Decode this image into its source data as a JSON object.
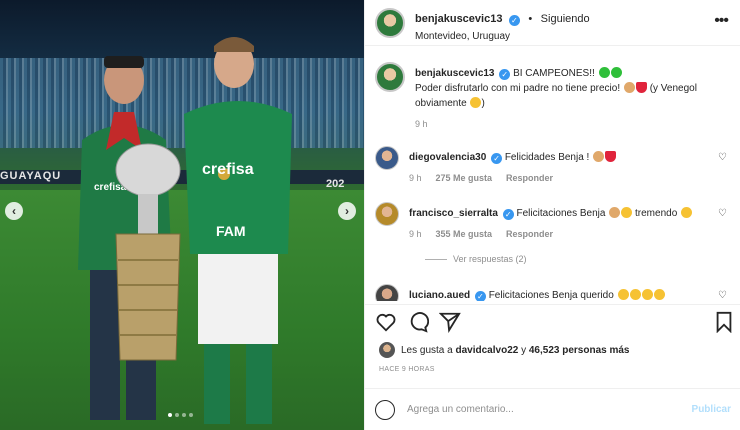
{
  "header": {
    "username": "benjakuscevic13",
    "follow_status": "Siguiendo",
    "location": "Montevideo, Uruguay"
  },
  "media": {
    "board_text_left": "GUAYAQU",
    "board_text_right": "202",
    "shirt_text": "crefisa",
    "sponsor_text": "FAM"
  },
  "caption": {
    "username": "benjakuscevic13",
    "text_1": "BI CAMPEONES!!",
    "text_2": "Poder disfrutarlo con mi padre no tiene precio!",
    "text_3": "(y Venegol obviamente",
    "text_4": ")",
    "time": "9 h"
  },
  "comments": [
    {
      "username": "diegovalencia30",
      "text": "Felicidades Benja !",
      "time": "9 h",
      "likes": "275 Me gusta",
      "reply": "Responder"
    },
    {
      "username": "francisco_sierralta",
      "text": "Felicitaciones Benja",
      "text_2": "tremendo",
      "time": "9 h",
      "likes": "355 Me gusta",
      "reply": "Responder",
      "view_replies": "Ver respuestas (2)"
    },
    {
      "username": "luciano.aued",
      "text": "Felicitaciones Benja querido"
    }
  ],
  "likes_line": {
    "prefix": "Les gusta a",
    "user": "davidcalvo22",
    "mid": "y",
    "count": "46,523 personas más"
  },
  "posted_ago": "HACE 9 HORAS",
  "comment_box": {
    "placeholder": "Agrega un comentario...",
    "publish": "Publicar"
  },
  "icons": [
    "heart-icon",
    "comment-icon",
    "share-icon",
    "bookmark-icon",
    "emoji-icon",
    "more-icon",
    "verified-icon"
  ],
  "colors": {
    "verified": "#3897f0",
    "publish_disabled": "#b2dffc",
    "meta_gray": "#8e8e8e"
  }
}
